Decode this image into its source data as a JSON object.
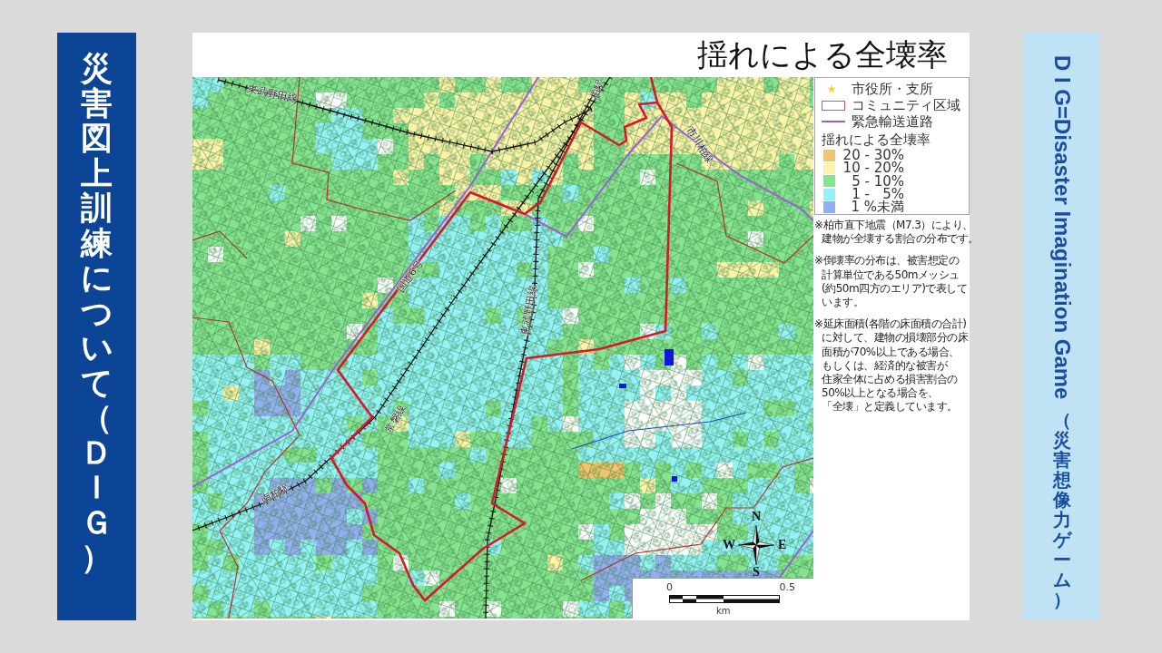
{
  "left_banner": {
    "title": "災害図上訓練について（ＤＩＧ）"
  },
  "slide": {
    "title": "揺れによる全壊率",
    "map": {
      "labels": [
        "東武野田線",
        "柏駅",
        "市川柏線",
        "国道6号",
        "東武野田線",
        "常磐線",
        "南柏駅"
      ],
      "compass": {
        "north": "N",
        "west": "W",
        "east": "E",
        "south": "S"
      },
      "scale": {
        "start": "0",
        "end": "0.5",
        "unit": "km"
      }
    },
    "legend": {
      "symbols": [
        {
          "kind": "star",
          "label": "市役所・支所"
        },
        {
          "kind": "outline",
          "label": "コミュニティ区域"
        },
        {
          "kind": "line",
          "label": "緊急輸送道路"
        }
      ],
      "heading": "揺れによる全壊率",
      "classes": [
        {
          "label": "20 - 30%",
          "color": "#f2c46c"
        },
        {
          "label": "10 - 20%",
          "color": "#fcf2a8"
        },
        {
          "label": "5 - 10%",
          "color": "#86e38f"
        },
        {
          "label": "1 -   5%",
          "color": "#93f2f6"
        },
        {
          "label": "1 %未満",
          "color": "#94aef0"
        }
      ]
    },
    "notes": [
      {
        "lines": [
          "※柏市直下地震（M7.3）により、",
          "建物が全壊する割合の分布です。"
        ]
      },
      {
        "lines": [
          "※倒壊率の分布は、被害想定の",
          "計算単位である50mメッシュ",
          "(約50m四方のエリア)で表して",
          "います。"
        ]
      },
      {
        "lines": [
          "※延床面積(各階の床面積の合計)",
          "に対して、建物の損壊部分の床",
          "面積が70%以上である場合、",
          "もしくは、経済的な被害が",
          "住家全体に占める損害割合の",
          "50%以上となる場合を、",
          "「全壊」と定義しています。"
        ]
      }
    ]
  },
  "right_banner": {
    "title": "D I G=Disaster Imagination Game",
    "subtitle": "（災害想像力ゲーム）"
  }
}
